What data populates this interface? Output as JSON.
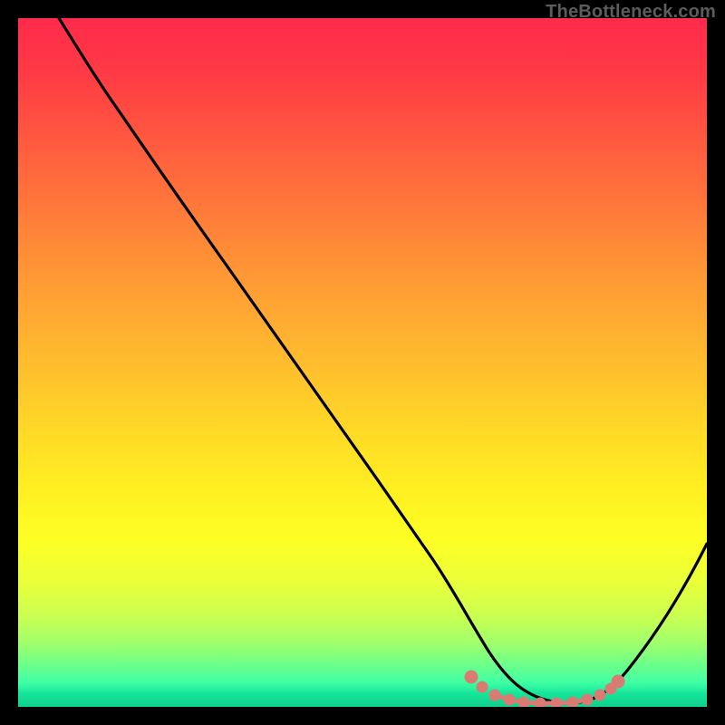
{
  "watermark": "TheBottleneck.com",
  "chart_data": {
    "type": "line",
    "title": "",
    "xlabel": "",
    "ylabel": "",
    "xlim": [
      0,
      100
    ],
    "ylim": [
      0,
      100
    ],
    "grid": false,
    "legend": false,
    "series": [
      {
        "name": "bottleneck-curve",
        "color": "#000000",
        "x": [
          6,
          10,
          14,
          20,
          30,
          40,
          50,
          60,
          63,
          66,
          70,
          74,
          78,
          82,
          84,
          88,
          92,
          96,
          100
        ],
        "y": [
          100,
          97,
          93,
          85,
          71,
          57,
          43,
          28,
          22,
          15,
          8,
          3,
          1,
          0.5,
          0.5,
          3,
          10,
          20,
          31
        ]
      },
      {
        "name": "optimal-region",
        "color": "#d97a73",
        "x": [
          65,
          67,
          69,
          71,
          73,
          75,
          77,
          79,
          81,
          83,
          85
        ],
        "y": [
          3.5,
          2.5,
          1.8,
          1.2,
          0.9,
          0.7,
          0.7,
          0.8,
          1.1,
          1.8,
          3.0
        ]
      }
    ],
    "background_gradient": {
      "top_color": "#ff2a4b",
      "mid_color": "#ffee22",
      "bottom_color": "#0ecf8c"
    }
  }
}
